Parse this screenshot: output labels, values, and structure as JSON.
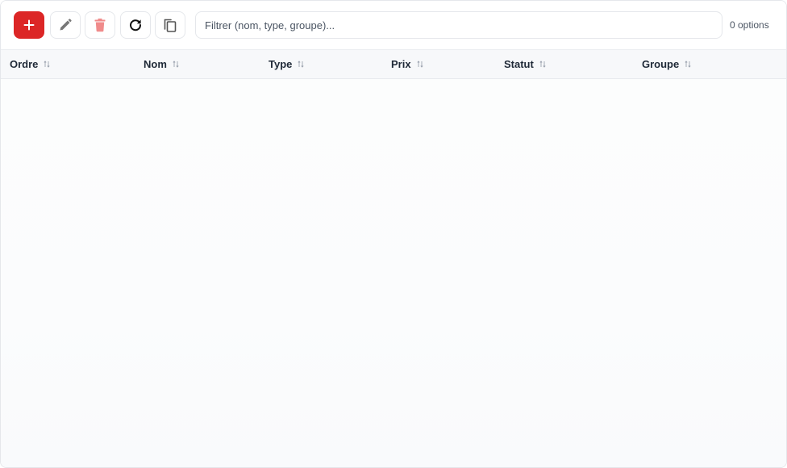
{
  "toolbar": {
    "buttons": [
      {
        "id": "add",
        "icon": "plus-icon"
      },
      {
        "id": "edit",
        "icon": "pencil-icon"
      },
      {
        "id": "delete",
        "icon": "trash-icon"
      },
      {
        "id": "refresh",
        "icon": "refresh-icon"
      },
      {
        "id": "copy",
        "icon": "copy-icon"
      }
    ],
    "filter_placeholder": "Filtrer (nom, type, groupe)...",
    "filter_value": "",
    "options_count": "0 options"
  },
  "table": {
    "columns": [
      {
        "label": "Ordre"
      },
      {
        "label": "Nom"
      },
      {
        "label": "Type"
      },
      {
        "label": "Prix"
      },
      {
        "label": "Statut"
      },
      {
        "label": "Groupe"
      }
    ],
    "rows": []
  },
  "colors": {
    "accent": "#dc2626",
    "delete_icon": "#f08b8b",
    "border": "#e5e7eb",
    "header_bg": "#f7f8fa"
  }
}
